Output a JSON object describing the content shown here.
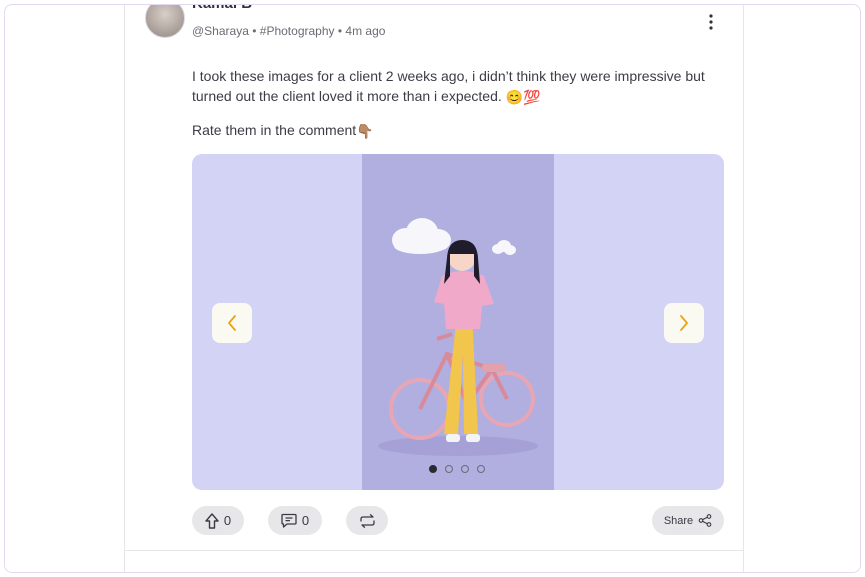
{
  "post": {
    "author": "Kamal B",
    "handle": "@Sharaya",
    "separator": "•",
    "tag": "#Photography",
    "time": "4m ago",
    "body_text": "I took these images for a client 2 weeks ago, i didn’t think they were impressive but turned out the client loved it more than i expected.",
    "body_emoji": "😊💯",
    "prompt_text": "Rate them in the comment",
    "prompt_emoji": "👇🏽"
  },
  "carousel": {
    "slide_count": 4,
    "active_index": 0,
    "background": "#d2d3f5",
    "slide_background": "#b1aee0",
    "arrow_color": "#e8a317"
  },
  "actions": {
    "upvotes": "0",
    "comments": "0",
    "share_label": "Share"
  },
  "icons": [
    "kebab-menu-icon",
    "chevron-left-icon",
    "chevron-right-icon",
    "upvote-arrow-icon",
    "comment-bubble-icon",
    "repost-icon",
    "share-nodes-icon"
  ]
}
